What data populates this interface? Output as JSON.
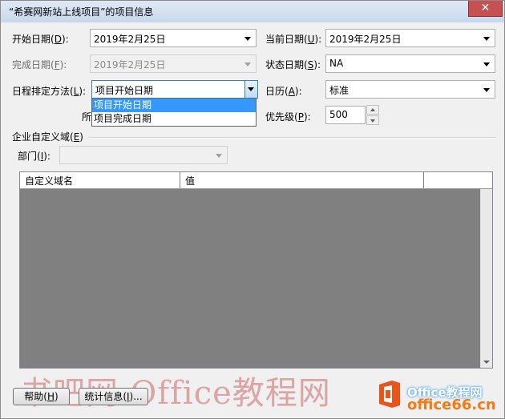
{
  "window": {
    "title": "“希赛网新站上线项目”的项目信息",
    "close_symbol": "✕"
  },
  "form": {
    "start_date": {
      "label": "开始日期(",
      "key": "D",
      "suffix": "):",
      "value": "2019年2月25日"
    },
    "finish_date": {
      "label": "完成日期(",
      "key": "F",
      "suffix": "):",
      "value": "2019年2月25日"
    },
    "schedule_from": {
      "label": "日程排定方法(",
      "key": "L",
      "suffix": "):",
      "value": "项目开始日期",
      "options": [
        "项目开始日期",
        "项目完成日期"
      ],
      "selected_index": 0
    },
    "partial_label": "所",
    "current_date": {
      "label": "当前日期(",
      "key": "U",
      "suffix": "):",
      "value": "2019年2月25日"
    },
    "status_date": {
      "label": "状态日期(",
      "key": "S",
      "suffix": "):",
      "value": "NA"
    },
    "calendar": {
      "label": "日历(",
      "key": "A",
      "suffix": "):",
      "value": "标准"
    },
    "priority": {
      "label": "优先级(",
      "key": "P",
      "suffix": "):",
      "value": "500"
    }
  },
  "enterprise": {
    "section_label": "企业自定义域(",
    "section_key": "E",
    "section_suffix": ")",
    "dept_label": "部门(",
    "dept_key": "I",
    "dept_suffix": "):",
    "dept_value": "",
    "columns": [
      "自定义域名",
      "值",
      ""
    ]
  },
  "buttons": {
    "help": {
      "label": "帮助(",
      "key": "H",
      "suffix": ")"
    },
    "stats": {
      "label": "统计信息(",
      "key": "I",
      "suffix": ")..."
    }
  },
  "watermark": {
    "left_text": "书吧网-Office教程网",
    "brand_line1": "Office教程网",
    "brand_line2": "office66.cn"
  }
}
